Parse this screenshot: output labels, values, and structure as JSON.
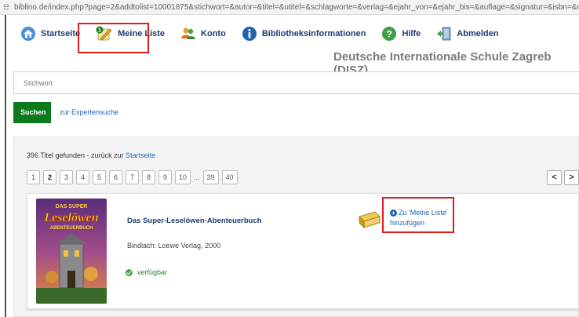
{
  "browser": {
    "url": "biblino.de/index.php?page=2&addtolist=10001875&stichwort=&autor=&titel=&utitel=&schlagworte=&verlag=&ejahr_von=&ejahr_bis=&auflage=&signatur=&isbn=&mnummer=&medienart=..."
  },
  "nav": {
    "startseite": "Startseite",
    "meine_liste": "Meine Liste",
    "meine_liste_badge": "1",
    "konto": "Konto",
    "bibliotheksinformationen": "Bibliotheksinformationen",
    "hilfe": "Hilfe",
    "abmelden": "Abmelden"
  },
  "school_name": "Deutsche Internationale Schule Zagreb (DISZ)",
  "search": {
    "placeholder": "Stichwort",
    "button": "Suchen",
    "expert_link": "zur Expertensuche"
  },
  "results": {
    "count_text": "396 Titel gefunden",
    "back_text": " - zurück zur ",
    "back_link": "Startseite",
    "pages": [
      "1",
      "2",
      "3",
      "4",
      "5",
      "6",
      "7",
      "8",
      "9",
      "10"
    ],
    "active_page": "2",
    "ellipsis": "...",
    "last_pages": [
      "39",
      "40"
    ],
    "prev": "<",
    "next": ">"
  },
  "item": {
    "title": "Das Super-Leselöwen-Abenteuerbuch",
    "publisher": "Bindlach: Loewe Verlag, 2000",
    "availability": "verfügbar",
    "add_line1": "Zu 'Meine Liste'",
    "add_line2": "hinzufügen",
    "cover_top": "DAS SUPER",
    "cover_main": "Leselöwen",
    "cover_sub": "ABENTEUERBUCH"
  },
  "colors": {
    "highlight": "#e01b1b",
    "nav_text": "#1f3b73",
    "search_button": "#0a7a1c",
    "link": "#1e62b3",
    "available": "#3fa64a"
  }
}
